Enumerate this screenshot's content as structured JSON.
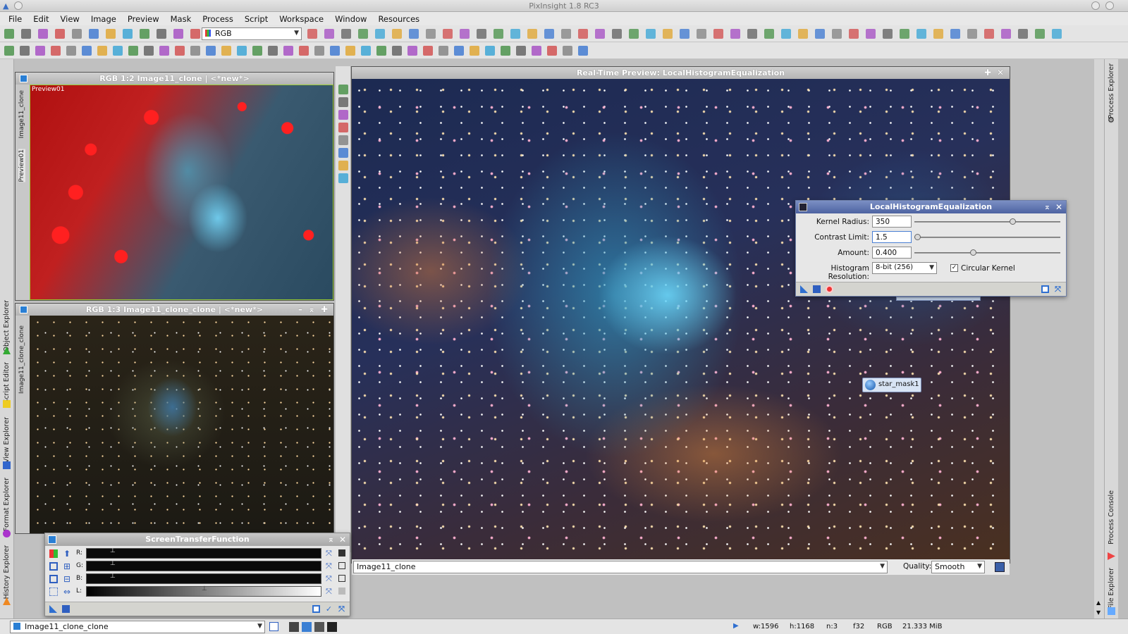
{
  "app": {
    "title": "PixInsight 1.8 RC3"
  },
  "menu": [
    "File",
    "Edit",
    "View",
    "Image",
    "Preview",
    "Mask",
    "Process",
    "Script",
    "Workspace",
    "Window",
    "Resources"
  ],
  "toolbar": {
    "channel_combo": "RGB"
  },
  "left_tabs": {
    "object_explorer": "Object Explorer",
    "script_editor": "Script Editor",
    "view_explorer": "View Explorer",
    "format_explorer": "Format Explorer",
    "history_explorer": "History Explorer"
  },
  "right_tabs": {
    "process_explorer": "Process Explorer",
    "process_console": "Process Console",
    "file_explorer": "File Explorer"
  },
  "win1": {
    "title": "RGB 1:2 Image11_clone | <*new*>",
    "preview_label": "Preview01",
    "side_tab_image": "Image11_clone",
    "side_tab_preview": "Preview01"
  },
  "win2": {
    "title": "RGB 1:3 Image11_clone_clone | <*new*>",
    "side_tab_image": "Image11_clone_clone"
  },
  "preview": {
    "title": "Real-Time Preview: LocalHistogramEqualization",
    "view_combo": "Image11_clone",
    "quality_label": "Quality:",
    "quality_value": "Smooth",
    "star_mask_label": "star_mask1"
  },
  "lhe": {
    "title": "LocalHistogramEqualization",
    "kernel_radius_label": "Kernel Radius:",
    "kernel_radius": "350",
    "contrast_limit_label": "Contrast Limit:",
    "contrast_limit": "1.5",
    "amount_label": "Amount:",
    "amount": "0.400",
    "histogram_resolution_label": "Histogram Resolution:",
    "histogram_resolution": "8-bit (256)",
    "circular_kernel_label": "Circular Kernel",
    "circular_kernel": true,
    "kernel_radius_slider_fraction": 0.67,
    "contrast_limit_slider_fraction": 0.02,
    "amount_slider_fraction": 0.4
  },
  "stf": {
    "title": "ScreenTransferFunction",
    "r": "R:",
    "g": "G:",
    "b": "B:",
    "l": "L:"
  },
  "statusbar": {
    "view": "Image11_clone_clone",
    "width": "w:1596",
    "height": "h:1168",
    "channels": "n:3",
    "format": "f32",
    "color": "RGB",
    "size": "21.333 MiB"
  }
}
